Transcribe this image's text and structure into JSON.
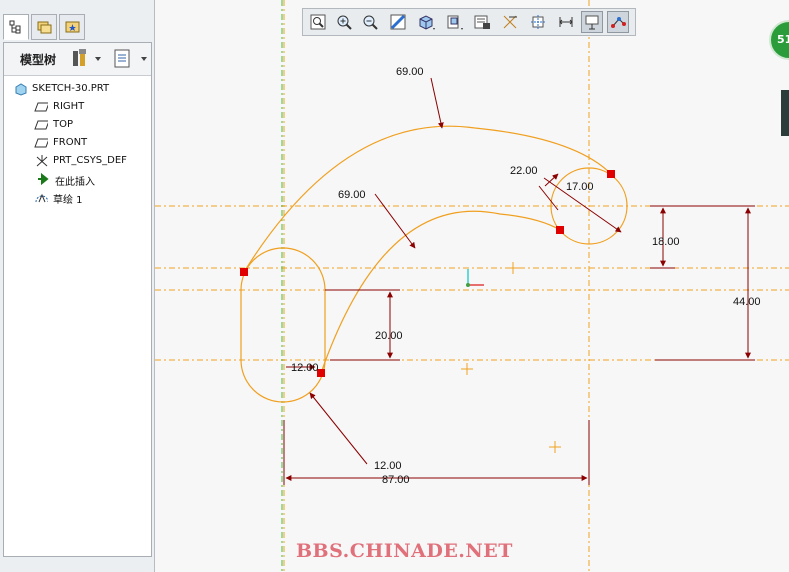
{
  "tree": {
    "header_title": "模型树",
    "items": [
      {
        "label": "SKETCH-30.PRT",
        "icon": "part-icon"
      },
      {
        "label": "RIGHT",
        "icon": "datum-plane-icon"
      },
      {
        "label": "TOP",
        "icon": "datum-plane-icon"
      },
      {
        "label": "FRONT",
        "icon": "datum-plane-icon"
      },
      {
        "label": "PRT_CSYS_DEF",
        "icon": "csys-icon"
      },
      {
        "label": "在此插入",
        "icon": "insert-here-arrow-icon"
      },
      {
        "label": "草绘 1",
        "icon": "sketch-icon"
      }
    ]
  },
  "badge": {
    "text": "51"
  },
  "dimensions": {
    "arc_outer": "69.00",
    "arc_inner": "69.00",
    "radius_small": "22.00",
    "radius_circle": "17.00",
    "v_18": "18.00",
    "v_44": "44.00",
    "v_20": "20.00",
    "slot_width": "12.00",
    "slot_radius": "12.00",
    "h_87": "87.00"
  },
  "watermark": "BBS.CHINADE.NET",
  "colors": {
    "geometry": "#f0a020",
    "dimension": "#8b0000",
    "centerline": "#3cbf3c",
    "endpoint": "#e00000"
  }
}
